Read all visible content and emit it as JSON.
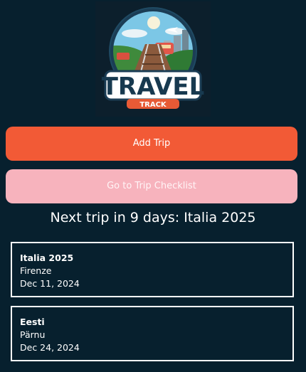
{
  "logo": {
    "word": "TRAVEL",
    "sub": "TRACK"
  },
  "actions": {
    "add_trip_label": "Add Trip",
    "checklist_label": "Go to Trip Checklist"
  },
  "next_trip_text": "Next trip in 9 days: Italia 2025",
  "trips": [
    {
      "name": "Italia 2025",
      "city": "Firenze",
      "date": "Dec 11, 2024"
    },
    {
      "name": "Eesti",
      "city": "Pärnu",
      "date": "Dec 24, 2024"
    }
  ],
  "colors": {
    "background": "#07202e",
    "add_button": "#f25a36",
    "checklist_button": "#f7b3bd",
    "card_border": "#ffffff"
  }
}
